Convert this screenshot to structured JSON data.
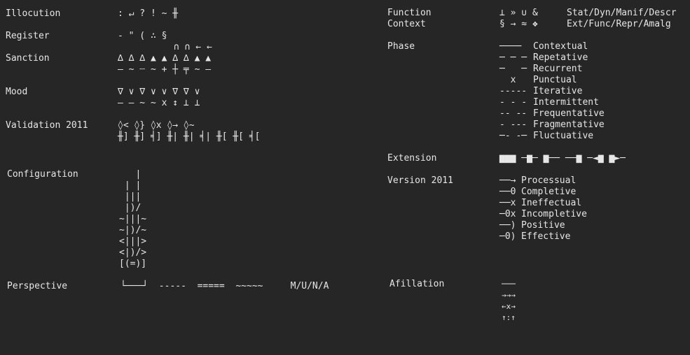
{
  "left": {
    "illocution": {
      "label": "Illocution",
      "glyphs": ": ↵ ? ! ~ ╫"
    },
    "register": {
      "label": "Register",
      "glyphs": "- \" ( ∴ §"
    },
    "sanction": {
      "label": "Sanction",
      "top": "∩ ∩ ← ←",
      "row1": "∆ ∆ ∆ ▲ ▲ ∆ ∆ ▲ ▲",
      "row2": "– ~ ┈ ~ + ┼ ╤ ~ –"
    },
    "mood": {
      "label": "Mood",
      "row1": "∇ ∨ ∇ ∨ ∨ ∇ ∇ ∨",
      "row2": "– – ~ ~ x ↕ ⊥ ⊥"
    },
    "validation": {
      "label": "Validation 2011",
      "row1": "◊< ◊} ◊x ◊→ ◊~",
      "row2": "╫] ╫] ╡] ╫| ╫| ╡| ╫[ ╫[ ╡["
    },
    "configuration": {
      "label": "Configuration",
      "lines": [
        "   |",
        " | |",
        " |||",
        " |)/",
        "~|||~",
        "~|)/~",
        "<|||>",
        "<|)/>",
        "[(=)]"
      ]
    },
    "perspective": {
      "label": "Perspective",
      "glyphs": "└───┘  -----  =====  ~~~~~     M/U/N/A"
    }
  },
  "right": {
    "function": {
      "label": "Function",
      "glyphs": "⊥ » ∪ &",
      "desc": "Stat/Dyn/Manif/Descr"
    },
    "context": {
      "label": "Context",
      "glyphs": "§ → ≈ ❖",
      "desc": "Ext/Func/Repr/Amalg"
    },
    "phase": {
      "label": "Phase",
      "rows": [
        {
          "sym": "────",
          "name": "Contextual"
        },
        {
          "sym": "─ ─ ─",
          "name": "Repetative"
        },
        {
          "sym": "─   ─",
          "name": "Recurrent"
        },
        {
          "sym": "  x",
          "name": "Punctual"
        },
        {
          "sym": "-----",
          "name": "Iterative"
        },
        {
          "sym": "- - -",
          "name": "Intermittent"
        },
        {
          "sym": "-- --",
          "name": "Frequentative"
        },
        {
          "sym": "- ---",
          "name": "Fragmentative"
        },
        {
          "sym": "─- -─",
          "name": "Fluctuative"
        }
      ]
    },
    "extension": {
      "label": "Extension",
      "glyphs": "▆▆▆ ─▆─ ▆── ──▆ ─◄▆ ▆►─"
    },
    "version": {
      "label": "Version 2011",
      "rows": [
        {
          "sym": "──→",
          "name": "Processual"
        },
        {
          "sym": "──0",
          "name": "Completive"
        },
        {
          "sym": "──x",
          "name": "Ineffectual"
        },
        {
          "sym": "─0x",
          "name": "Incompletive"
        },
        {
          "sym": "──)",
          "name": "Positive"
        },
        {
          "sym": "─0)",
          "name": "Effective"
        }
      ]
    },
    "afillation": {
      "label": "Afillation",
      "lines": [
        "───",
        "→→→",
        "←x→",
        "↑:↑"
      ]
    }
  }
}
